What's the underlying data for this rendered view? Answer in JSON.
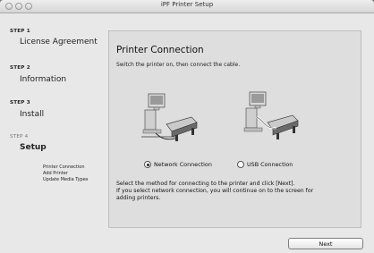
{
  "window": {
    "title": "iPF Printer Setup"
  },
  "steps": [
    {
      "label": "STEP 1",
      "name": "License Agreement"
    },
    {
      "label": "STEP 2",
      "name": "Information"
    },
    {
      "label": "STEP 3",
      "name": "Install"
    },
    {
      "label": "STEP 4",
      "name": "Setup",
      "current": true
    }
  ],
  "substeps": [
    "Printer Connection",
    "Add Printer",
    "Update Media Types"
  ],
  "main": {
    "heading": "Printer Connection",
    "intro": "Switch the printer on, then connect the cable.",
    "options": [
      {
        "label": "Network Connection",
        "selected": true,
        "icon": "network-printer-illustration-icon"
      },
      {
        "label": "USB Connection",
        "selected": false,
        "icon": "usb-printer-illustration-icon"
      }
    ],
    "instruction_line1": "Select the method for connecting to the printer and click [Next].",
    "instruction_line2": "If you select network connection, you will continue on to the screen for",
    "instruction_line3": "adding printers."
  },
  "footer": {
    "next_label": "Next"
  }
}
